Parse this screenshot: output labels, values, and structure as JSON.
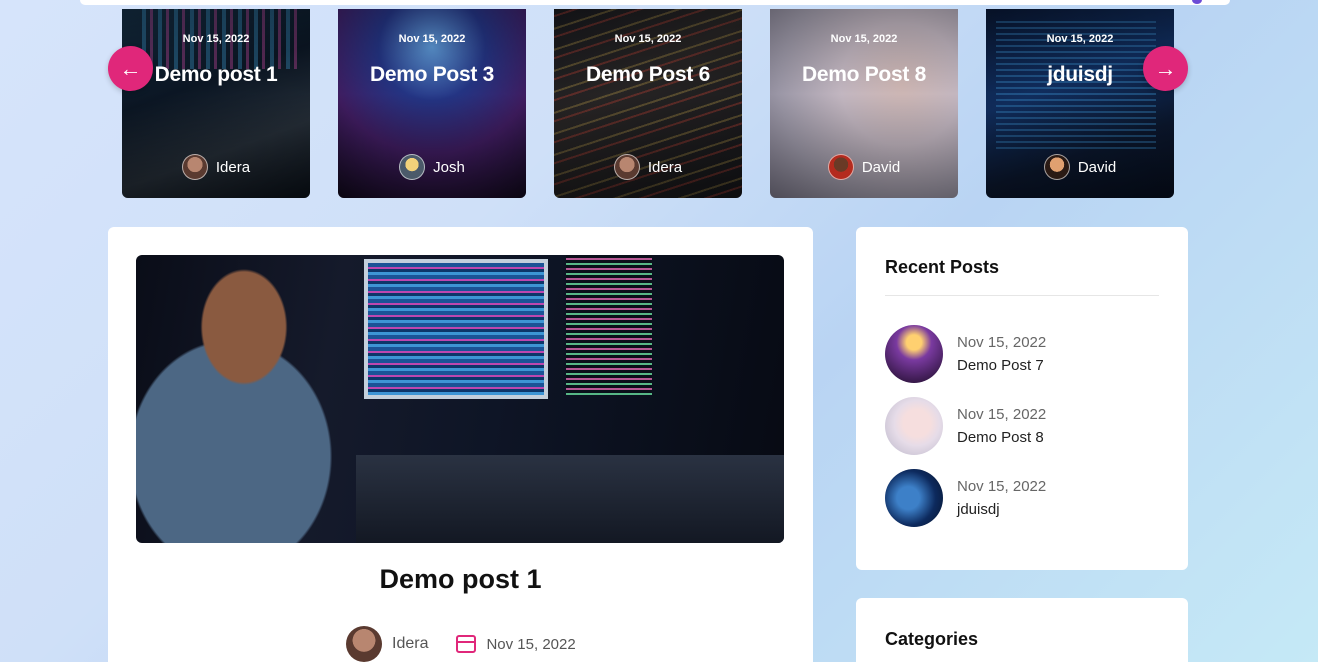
{
  "carousel": {
    "cards": [
      {
        "date": "Nov 15, 2022",
        "title": "Demo post 1",
        "author": "Idera"
      },
      {
        "date": "Nov 15, 2022",
        "title": "Demo Post 3",
        "author": "Josh"
      },
      {
        "date": "Nov 15, 2022",
        "title": "Demo Post 6",
        "author": "Idera"
      },
      {
        "date": "Nov 15, 2022",
        "title": "Demo Post 8",
        "author": "David"
      },
      {
        "date": "Nov 15, 2022",
        "title": "jduisdj",
        "author": "David"
      }
    ],
    "prev_icon": "←",
    "next_icon": "→"
  },
  "post": {
    "title": "Demo post 1",
    "author": "Idera",
    "date": "Nov 15, 2022"
  },
  "sidebar": {
    "recent_title": "Recent Posts",
    "recent": [
      {
        "date": "Nov 15, 2022",
        "title": "Demo Post 7"
      },
      {
        "date": "Nov 15, 2022",
        "title": "Demo Post 8"
      },
      {
        "date": "Nov 15, 2022",
        "title": "jduisdj"
      }
    ],
    "categories_title": "Categories"
  },
  "colors": {
    "accent": "#e0277a"
  }
}
